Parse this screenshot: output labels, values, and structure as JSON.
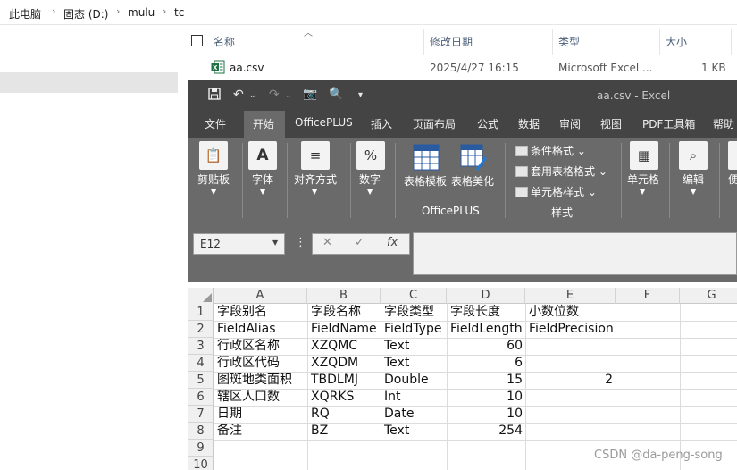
{
  "explorer": {
    "breadcrumb": [
      "此电脑",
      "固态 (D:)",
      "mulu",
      "tc"
    ],
    "columns": {
      "name": "名称",
      "modified": "修改日期",
      "type": "类型",
      "size": "大小"
    },
    "file": {
      "name": "aa.csv",
      "modified": "2025/4/27 16:15",
      "type": "Microsoft Excel ...",
      "size": "1 KB"
    }
  },
  "excel": {
    "title": "aa.csv  -  Excel",
    "tabs": [
      "文件",
      "开始",
      "OfficePLUS",
      "插入",
      "页面布局",
      "公式",
      "数据",
      "审阅",
      "视图",
      "PDF工具箱",
      "帮助"
    ],
    "active_tab": "开始",
    "ribbon": {
      "clipboard": "剪贴板",
      "font": "字体",
      "alignment": "对齐方式",
      "number": "数字",
      "table_template": "表格模板",
      "table_beautify": "表格美化",
      "officeplus_group": "OfficePLUS",
      "conditional_format": "条件格式",
      "format_as_table": "套用表格格式",
      "cell_styles": "单元格样式",
      "styles_group": "样式",
      "cells": "单元格",
      "editing": "编辑",
      "partial": "便"
    },
    "name_box": "E12",
    "column_headers": [
      "A",
      "B",
      "C",
      "D",
      "E",
      "F",
      "G"
    ],
    "row_headers": [
      "1",
      "2",
      "3",
      "4",
      "5",
      "6",
      "7",
      "8",
      "9",
      "10"
    ],
    "rows": [
      [
        "字段别名",
        "字段名称",
        "字段类型",
        "字段长度",
        "小数位数"
      ],
      [
        "FieldAlias",
        "FieldName",
        "FieldType",
        "FieldLength",
        "FieldPrecision"
      ],
      [
        "行政区名称",
        "XZQMC",
        "Text",
        "60",
        ""
      ],
      [
        "行政区代码",
        "XZQDM",
        "Text",
        "6",
        ""
      ],
      [
        "图斑地类面积",
        "TBDLMJ",
        "Double",
        "15",
        "2"
      ],
      [
        "辖区人口数",
        "XQRKS",
        "Int",
        "10",
        ""
      ],
      [
        "日期",
        "RQ",
        "Date",
        "10",
        ""
      ],
      [
        "备注",
        "BZ",
        "Text",
        "254",
        ""
      ]
    ]
  },
  "watermark": "CSDN @da-peng-song"
}
